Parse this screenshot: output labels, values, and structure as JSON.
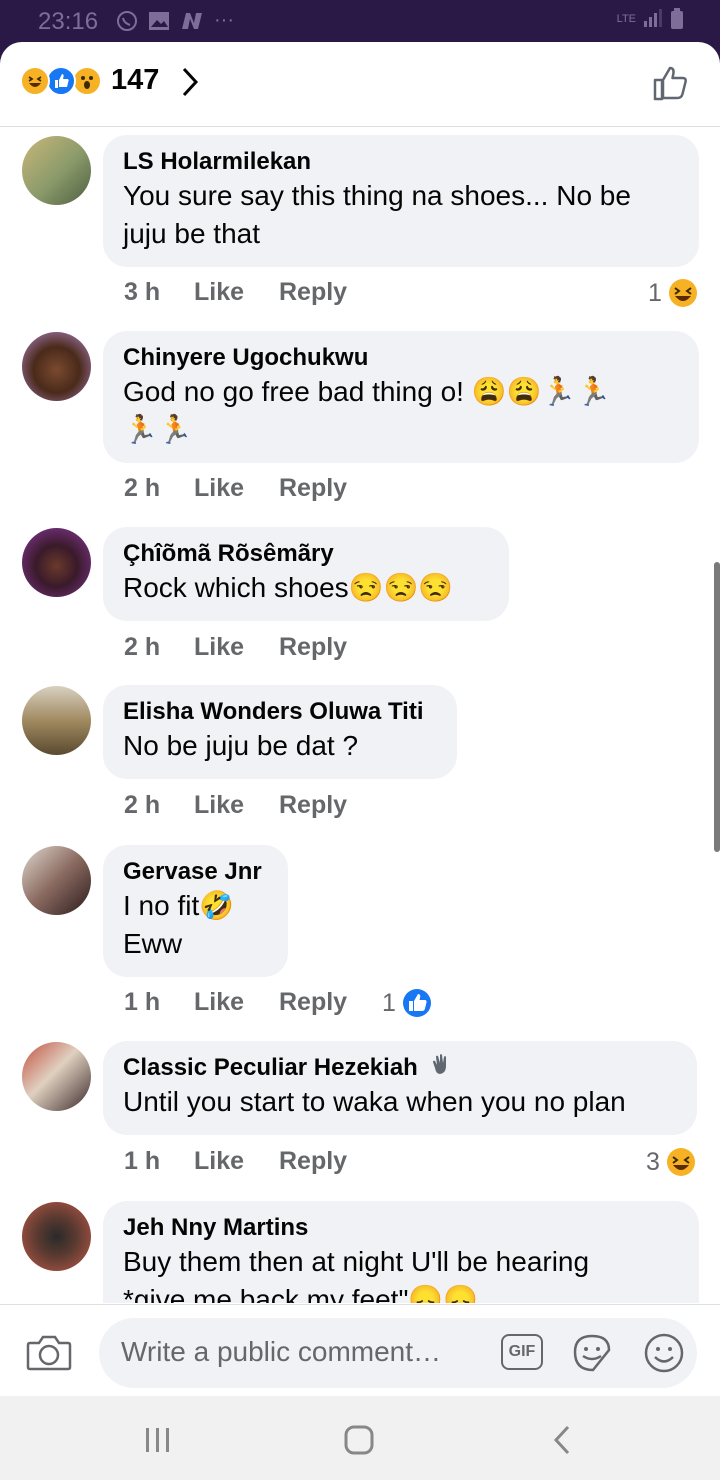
{
  "status_bar": {
    "time": "23:16",
    "network": "LTE"
  },
  "header": {
    "reaction_count": "147"
  },
  "comments": [
    {
      "name": "LS Holarmilekan",
      "lines": [
        "You sure say this thing na shoes... No be",
        "juju be that"
      ],
      "time": "3 h",
      "like": "Like",
      "reply": "Reply",
      "reactions": "1",
      "reaction_type": "haha"
    },
    {
      "name": "Chinyere Ugochukwu",
      "lines": [
        "God no go free bad thing o! 😩😩🏃🏃",
        "🏃🏃"
      ],
      "time": "2 h",
      "like": "Like",
      "reply": "Reply"
    },
    {
      "name": "Çhîõmã Rõsêmãry",
      "lines": [
        "Rock which shoes😒😒😒"
      ],
      "time": "2 h",
      "like": "Like",
      "reply": "Reply"
    },
    {
      "name": "Elisha Wonders Oluwa Titi",
      "lines": [
        "No be juju be dat ?"
      ],
      "time": "2 h",
      "like": "Like",
      "reply": "Reply"
    },
    {
      "name": "Gervase Jnr",
      "lines": [
        "I no fit🤣",
        "Eww"
      ],
      "time": "1 h",
      "like": "Like",
      "reply": "Reply",
      "reactions": "1",
      "reaction_type": "like"
    },
    {
      "name": "Classic Peculiar Hezekiah",
      "name_badge": "wave-icon",
      "lines": [
        "Until you start to waka when you no plan"
      ],
      "time": "1 h",
      "like": "Like",
      "reply": "Reply",
      "reactions": "3",
      "reaction_type": "haha"
    },
    {
      "name": "Jeh Nny Martins",
      "lines": [
        "Buy them then at night U'll be hearing",
        "*give me back my feet\"😞😞"
      ],
      "time": "",
      "like": "",
      "reply": ""
    }
  ],
  "composer": {
    "placeholder": "Write a public comment…",
    "gif_label": "GIF"
  },
  "colors": {
    "like_blue": "#1877f2",
    "haha_yellow": "#f7b125",
    "bubble": "#f0f2f5",
    "meta_gray": "#65676b"
  }
}
